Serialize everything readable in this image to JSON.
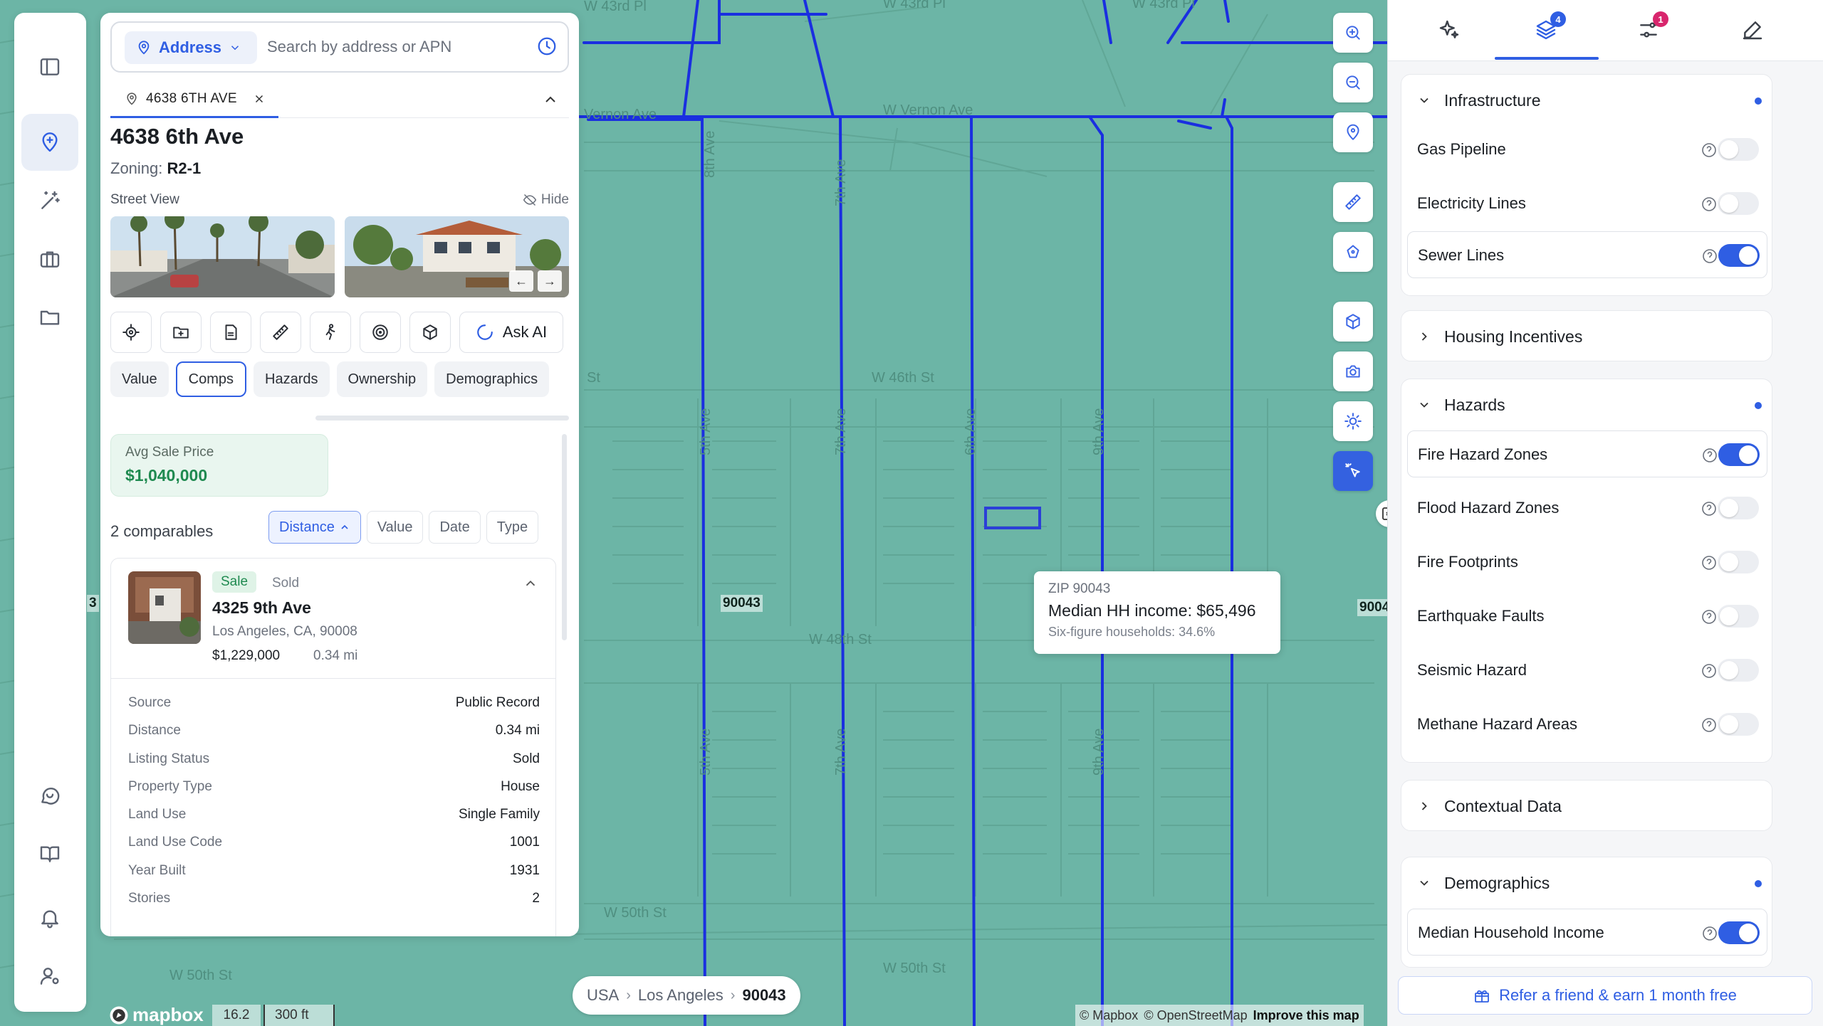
{
  "search": {
    "mode_label": "Address",
    "placeholder": "Search by address or APN"
  },
  "property_tab": {
    "label": "4638 6TH AVE"
  },
  "property": {
    "title": "4638 6th Ave",
    "zoning_label": "Zoning:",
    "zoning_value": "R2-1",
    "street_view_label": "Street View",
    "hide_label": "Hide"
  },
  "actions": {
    "ask_ai_label": "Ask AI"
  },
  "section_tabs": [
    "Value",
    "Comps",
    "Hazards",
    "Ownership",
    "Demographics"
  ],
  "active_section": "Comps",
  "comps": {
    "avg_label": "Avg Sale Price",
    "avg_value": "$1,040,000",
    "count_label": "2 comparables",
    "sort_options": [
      "Distance",
      "Value",
      "Date",
      "Type"
    ],
    "active_sort": "Distance",
    "card": {
      "badge": "Sale",
      "status": "Sold",
      "address": "4325 9th Ave",
      "city": "Los Angeles, CA, 90008",
      "price": "$1,229,000",
      "distance": "0.34 mi",
      "details": [
        {
          "key": "Source",
          "value": "Public Record"
        },
        {
          "key": "Distance",
          "value": "0.34 mi"
        },
        {
          "key": "Listing Status",
          "value": "Sold"
        },
        {
          "key": "Property Type",
          "value": "House"
        },
        {
          "key": "Land Use",
          "value": "Single Family"
        },
        {
          "key": "Land Use Code",
          "value": "1001"
        },
        {
          "key": "Year Built",
          "value": "1931"
        },
        {
          "key": "Stories",
          "value": "2"
        }
      ]
    }
  },
  "map": {
    "tooltip": {
      "zip": "ZIP 90043",
      "metric": "Median HH income: $65,496",
      "sub": "Six-figure households: 34.6%"
    },
    "zip_labels": [
      "90043",
      "9004",
      "3"
    ],
    "street_labels": [
      "W 46th St",
      "W 48th St",
      "W 50th St",
      "W 50th St",
      "W 50th St",
      "W 43rd Pl",
      "W 43rd Pl",
      "W 43rd Pl",
      "W Vernon Ave",
      "Vernon Ave",
      "8th Ave",
      "7th Ave",
      "7th Ave",
      "7th Ave",
      "5th Ave",
      "5th Ave",
      "6th Ave",
      "9th Ave",
      "9th Ave",
      "St"
    ],
    "breadcrumb": [
      "USA",
      "Los Angeles",
      "90043"
    ],
    "zoom": "16.2",
    "scale": "300 ft",
    "attribution": [
      "© Mapbox",
      "© OpenStreetMap",
      "Improve this map"
    ],
    "logo": "mapbox"
  },
  "layers_panel": {
    "tab_badges": {
      "layers": "4",
      "filters": "1"
    },
    "groups": [
      {
        "title": "Infrastructure",
        "expanded": true,
        "has_active": true,
        "items": [
          {
            "label": "Gas Pipeline",
            "on": false
          },
          {
            "label": "Electricity Lines",
            "on": false
          },
          {
            "label": "Sewer Lines",
            "on": true
          }
        ]
      },
      {
        "title": "Housing Incentives",
        "expanded": false,
        "has_active": false,
        "items": []
      },
      {
        "title": "Hazards",
        "expanded": true,
        "has_active": true,
        "items": [
          {
            "label": "Fire Hazard Zones",
            "on": true
          },
          {
            "label": "Flood Hazard Zones",
            "on": false
          },
          {
            "label": "Fire Footprints",
            "on": false
          },
          {
            "label": "Earthquake Faults",
            "on": false
          },
          {
            "label": "Seismic Hazard",
            "on": false
          },
          {
            "label": "Methane Hazard Areas",
            "on": false
          }
        ]
      },
      {
        "title": "Contextual Data",
        "expanded": false,
        "has_active": false,
        "items": []
      },
      {
        "title": "Demographics",
        "expanded": true,
        "has_active": true,
        "items": [
          {
            "label": "Median Household Income",
            "on": true
          }
        ]
      }
    ],
    "refer_label": "Refer a friend & earn 1 month free"
  },
  "colors": {
    "accent": "#2f5ee3",
    "map_fill": "#6cb5a6",
    "sewer_line": "#1a2fe0",
    "success": "#1f8a50"
  }
}
